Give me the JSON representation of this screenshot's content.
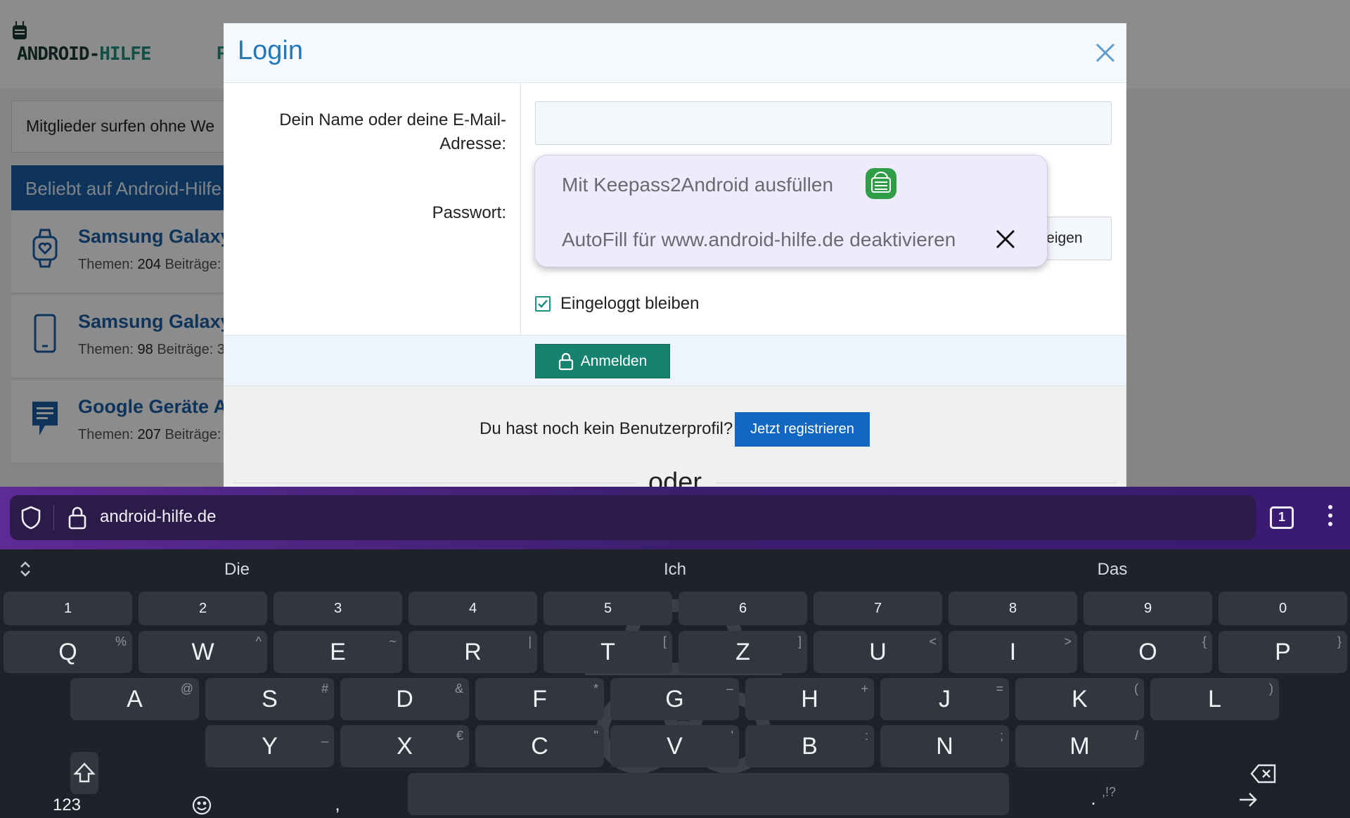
{
  "site": {
    "logo_text_a": "ANDROID-",
    "logo_text_b": "HILFE",
    "nav_partial": "F",
    "members_notice": "Mitglieder surfen ohne We",
    "popular_header": "Beliebt auf Android-Hilfe",
    "forums": [
      {
        "title": "Samsung Galaxy",
        "meta_label_a": "Themen:",
        "topics": "204",
        "meta_label_b": "Beiträge:",
        "icon": "smartwatch-icon"
      },
      {
        "title": "Samsung Galaxy",
        "meta_label_a": "Themen:",
        "topics": "98",
        "meta_label_b": "Beiträge: 3",
        "icon": "smartphone-icon"
      },
      {
        "title": "Google Geräte A",
        "meta_label_a": "Themen:",
        "topics": "207",
        "meta_label_b": "Beiträge:",
        "icon": "chat-icon"
      }
    ]
  },
  "modal": {
    "title": "Login",
    "name_label": "Dein Name oder deine E-Mail-Adresse:",
    "name_value": "",
    "password_label": "Passwort:",
    "show_password": "Anzeigen",
    "stay_logged_in": "Eingeloggt bleiben",
    "stay_logged_in_checked": true,
    "login_button": "Anmelden",
    "no_account_text": "Du hast noch kein Benutzerprofil?",
    "register_button": "Jetzt registrieren",
    "or_text": "oder"
  },
  "autofill": {
    "keepass_label": "Mit Keepass2Android ausfüllen",
    "disable_label": "AutoFill für www.android-hilfe.de deaktivieren"
  },
  "browser": {
    "url": "android-hilfe.de",
    "tab_count": "1"
  },
  "keyboard": {
    "suggestions": [
      "Die",
      "Ich",
      "Das"
    ],
    "numbers": [
      "1",
      "2",
      "3",
      "4",
      "5",
      "6",
      "7",
      "8",
      "9",
      "0"
    ],
    "row1": [
      {
        "k": "Q",
        "a": "%"
      },
      {
        "k": "W",
        "a": "^"
      },
      {
        "k": "E",
        "a": "~"
      },
      {
        "k": "R",
        "a": "|"
      },
      {
        "k": "T",
        "a": "["
      },
      {
        "k": "Z",
        "a": "]"
      },
      {
        "k": "U",
        "a": "<"
      },
      {
        "k": "I",
        "a": ">"
      },
      {
        "k": "O",
        "a": "{"
      },
      {
        "k": "P",
        "a": "}"
      }
    ],
    "row2": [
      {
        "k": "A",
        "a": "@"
      },
      {
        "k": "S",
        "a": "#"
      },
      {
        "k": "D",
        "a": "&"
      },
      {
        "k": "F",
        "a": "*"
      },
      {
        "k": "G",
        "a": "–"
      },
      {
        "k": "H",
        "a": "+"
      },
      {
        "k": "J",
        "a": "="
      },
      {
        "k": "K",
        "a": "("
      },
      {
        "k": "L",
        "a": ")"
      }
    ],
    "row3": [
      {
        "k": "Y",
        "a": "_"
      },
      {
        "k": "X",
        "a": "€"
      },
      {
        "k": "C",
        "a": "\""
      },
      {
        "k": "V",
        "a": "'"
      },
      {
        "k": "B",
        "a": ":"
      },
      {
        "k": "N",
        "a": ";"
      },
      {
        "k": "M",
        "a": "/"
      }
    ],
    "symbols_key": "123",
    "comma_key": ",",
    "period_key": ".",
    "period_alt": ",!?"
  },
  "colors": {
    "brand_green": "#1e8f80",
    "link_blue": "#1a5fa8",
    "modal_title": "#2277b8",
    "login_button": "#15836f",
    "register_button": "#1167c2",
    "browser_bar": "#3b1f6e",
    "keyboard_bg": "#1f222b"
  }
}
